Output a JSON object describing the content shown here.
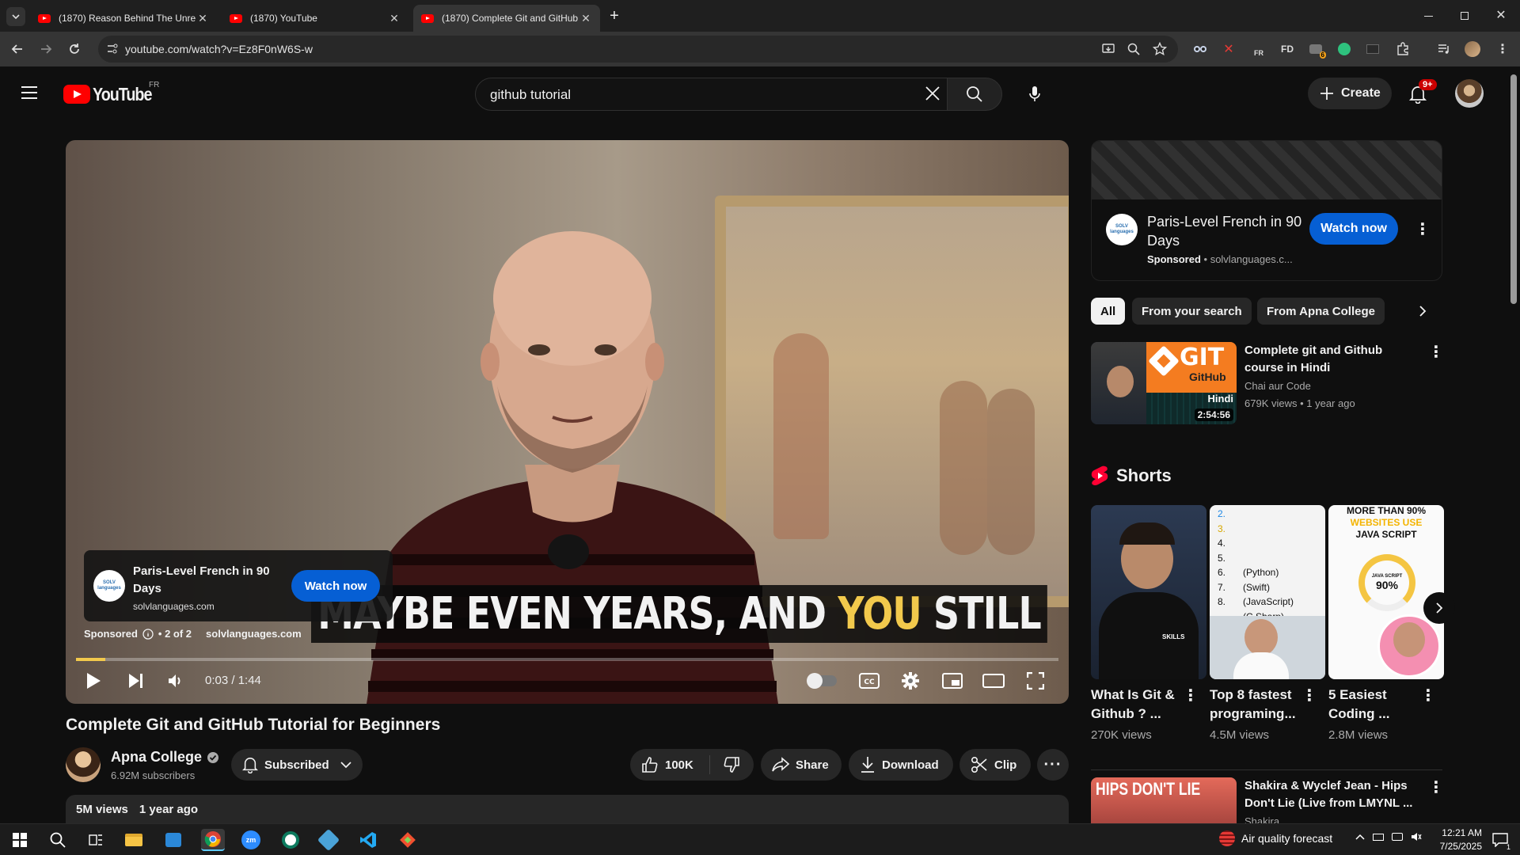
{
  "browser": {
    "tabs": [
      {
        "title": "(1870) Reason Behind The Unre"
      },
      {
        "title": "(1870) YouTube"
      },
      {
        "title": "(1870) Complete Git and GitHub"
      }
    ],
    "url": "youtube.com/watch?v=Ez8F0nW6S-w",
    "extensions": [
      "eyes-icon",
      "red-x-icon",
      "translate-fr-icon",
      "fd-icon",
      "badge-6-icon",
      "green-circle-icon",
      "window-icon",
      "puzzle-icon"
    ],
    "ext_labels": {
      "fr": "FR",
      "fd": "FD",
      "badge": "6"
    }
  },
  "youtube": {
    "logo_text": "YouTube",
    "country_code": "FR",
    "search_value": "github tutorial",
    "create_label": "Create",
    "notifications_badge": "9+"
  },
  "player": {
    "caption_pre": "MAYBE EVEN YEARS, AND ",
    "caption_highlight": "YOU",
    "caption_post": " STILL",
    "ad": {
      "title": "Paris-Level French in 90 Days",
      "domain": "solvlanguages.com",
      "cta": "Watch now",
      "logo_text": "SOLV languages",
      "sponsored": "Sponsored",
      "position": "• 2 of 2",
      "domain_bottom": "solvlanguages.com"
    },
    "time": "0:03 / 1:44",
    "progress": 0.03
  },
  "video": {
    "title": "Complete Git and GitHub Tutorial for Beginners",
    "channel": "Apna College",
    "subscribers": "6.92M subscribers",
    "subscribe_label": "Subscribed",
    "likes": "100K",
    "share_label": "Share",
    "download_label": "Download",
    "clip_label": "Clip",
    "views": "5M views",
    "age": "1 year ago"
  },
  "sidebar": {
    "ad": {
      "title": "Paris-Level French in 90 Days",
      "sponsored": "Sponsored",
      "domain": "solvlanguages.c...",
      "cta": "Watch now",
      "logo_text": "SOLV languages"
    },
    "chips": [
      "All",
      "From your search",
      "From Apna College"
    ],
    "recommended": [
      {
        "title": "Complete git and Github course in Hindi",
        "channel": "Chai aur Code",
        "meta": "679K views • 1 year ago",
        "duration": "2:54:56",
        "thumb_git": "GIT",
        "thumb_github": "GitHub",
        "thumb_hindi": "Hindi"
      }
    ],
    "shorts_heading": "Shorts",
    "shorts": [
      {
        "title": "What Is Git & Github ? ...",
        "views": "270K views"
      },
      {
        "title": "Top 8 fastest programing...",
        "views": "4.5M views"
      },
      {
        "title": "5 Easiest Coding ...",
        "views": "2.8M views"
      }
    ],
    "short2_list": [
      "2.",
      "3.",
      "4.",
      "5.",
      "6.",
      "7.",
      "8."
    ],
    "short2_items": [
      "(Python)",
      "(Swift)",
      "(JavaScript)",
      "(C Sharp)"
    ],
    "short3_text": {
      "top": "MORE THAN 90%",
      "mid": "WEBSITES USE",
      "bottom": "JAVA SCRIPT",
      "gauge_label": "JAVA SCRIPT",
      "gauge_value": "90%"
    },
    "short1_badge": "SKILLS",
    "next_rec": {
      "title": "Shakira & Wyclef Jean - Hips Don't Lie (Live from LMYNL ...",
      "channel": "Shakira",
      "thumb_text": "HIPS DON'T LIE"
    }
  },
  "taskbar": {
    "weather": "Air quality forecast",
    "time": "12:21 AM",
    "date": "7/25/2025",
    "notif_count": "1"
  }
}
